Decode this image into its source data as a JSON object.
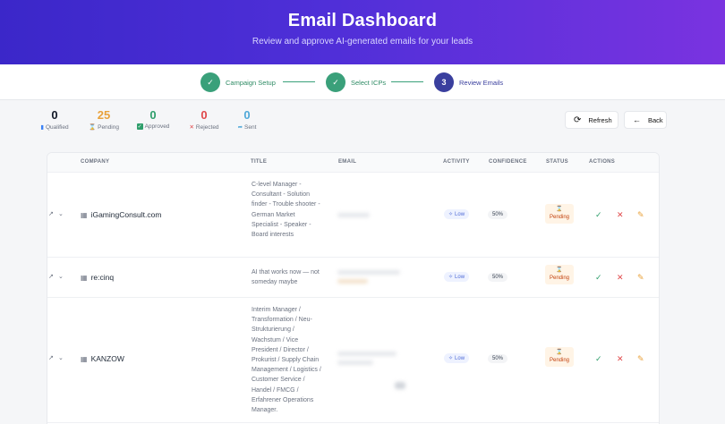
{
  "header": {
    "title": "Email Dashboard",
    "subtitle": "Review and approve AI-generated emails for your leads"
  },
  "stepper": {
    "steps": [
      {
        "label": "Campaign Setup",
        "state": "done"
      },
      {
        "label": "Select ICPs",
        "state": "done"
      },
      {
        "num": "3",
        "label": "Review Emails",
        "state": "active"
      }
    ]
  },
  "stats": [
    {
      "value": "0",
      "label": "Qualified",
      "icon": "bar-chart-icon",
      "color": "#111827"
    },
    {
      "value": "25",
      "label": "Pending",
      "icon": "hourglass-icon",
      "color": "#e9a23b"
    },
    {
      "value": "0",
      "label": "Approved",
      "icon": "check-box-icon",
      "color": "#2e9e6b"
    },
    {
      "value": "0",
      "label": "Rejected",
      "icon": "x-icon",
      "color": "#e0484a"
    },
    {
      "value": "0",
      "label": "Sent",
      "icon": "send-icon",
      "color": "#4fa8d8"
    }
  ],
  "toolbar": {
    "refresh_label": "Refresh",
    "back_label": "Back"
  },
  "table": {
    "headers": {
      "company": "COMPANY",
      "title": "TITLE",
      "email": "EMAIL",
      "activity": "ACTIVITY",
      "confidence": "CONFIDENCE",
      "status": "STATUS",
      "actions": "ACTIONS"
    },
    "rows": [
      {
        "company": "iGamingConsult.com",
        "title": "C-level Manager - Consultant - Solution finder - Trouble shooter - German Market Specialist - Speaker - Board interests",
        "activity": "Low",
        "confidence": "50%",
        "status": "Pending"
      },
      {
        "company": "re:cinq",
        "title": "AI that works now — not someday maybe",
        "activity": "Low",
        "confidence": "50%",
        "status": "Pending"
      },
      {
        "company": "KANZOW",
        "title": "Interim Manager / Transformation / Neu-Strukturierung / Wachstum / Vice President / Director / Prokurist / Supply Chain Management / Logistics / Customer Service / Handel / FMCG / Erfahrener Operations Manager.",
        "activity": "Low",
        "confidence": "50%",
        "status": "Pending"
      }
    ]
  },
  "colors": {
    "header_start": "#3b27c9",
    "header_end": "#7a33e0",
    "done": "#3aa07a",
    "active": "#3a3f9e",
    "pending": "#e9a23b"
  }
}
